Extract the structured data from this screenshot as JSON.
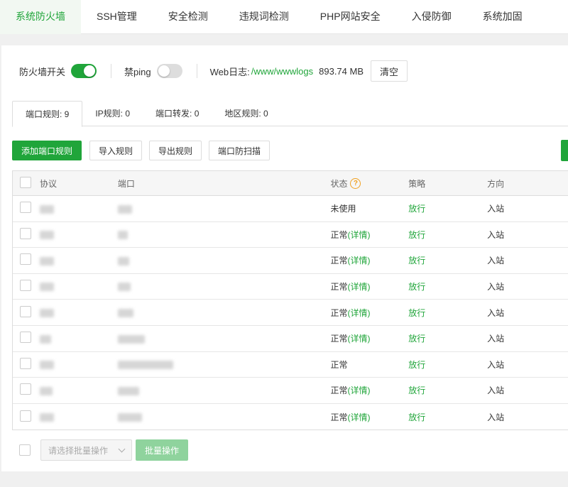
{
  "top_tabs": [
    {
      "label": "系统防火墙"
    },
    {
      "label": "SSH管理"
    },
    {
      "label": "安全检测"
    },
    {
      "label": "违规词检测"
    },
    {
      "label": "PHP网站安全"
    },
    {
      "label": "入侵防御"
    },
    {
      "label": "系统加固"
    }
  ],
  "status_bar": {
    "firewall_label": "防火墙开关",
    "firewall_enabled": true,
    "ping_label": "禁ping",
    "ping_enabled": false,
    "log_label": "Web日志:",
    "log_path": "/www/wwwlogs",
    "log_size": "893.74 MB",
    "clear_label": "清空"
  },
  "sub_tabs": [
    {
      "label": "端口规则:  9"
    },
    {
      "label": "IP规则:  0"
    },
    {
      "label": "端口转发:  0"
    },
    {
      "label": "地区规则:  0"
    }
  ],
  "toolbar": {
    "add_label": "添加端口规则",
    "import_label": "导入规则",
    "export_label": "导出规则",
    "scan_label": "端口防扫描"
  },
  "table": {
    "headers": {
      "protocol": "协议",
      "port": "端口",
      "status": "状态",
      "policy": "策略",
      "direction": "方向"
    },
    "rows": [
      {
        "status": "未使用",
        "detail": "",
        "policy": "放行",
        "direction": "入站"
      },
      {
        "status": "正常",
        "detail": "(详情)",
        "policy": "放行",
        "direction": "入站"
      },
      {
        "status": "正常",
        "detail": "(详情)",
        "policy": "放行",
        "direction": "入站"
      },
      {
        "status": "正常",
        "detail": "(详情)",
        "policy": "放行",
        "direction": "入站"
      },
      {
        "status": "正常",
        "detail": "(详情)",
        "policy": "放行",
        "direction": "入站"
      },
      {
        "status": "正常",
        "detail": "(详情)",
        "policy": "放行",
        "direction": "入站"
      },
      {
        "status": "正常",
        "detail": "",
        "policy": "放行",
        "direction": "入站"
      },
      {
        "status": "正常",
        "detail": "(详情)",
        "policy": "放行",
        "direction": "入站"
      },
      {
        "status": "正常",
        "detail": "(详情)",
        "policy": "放行",
        "direction": "入站"
      }
    ]
  },
  "footer": {
    "batch_placeholder": "请选择批量操作",
    "batch_button": "批量操作"
  },
  "colors": {
    "accent": "#20a53a",
    "warning": "#f0a020"
  }
}
